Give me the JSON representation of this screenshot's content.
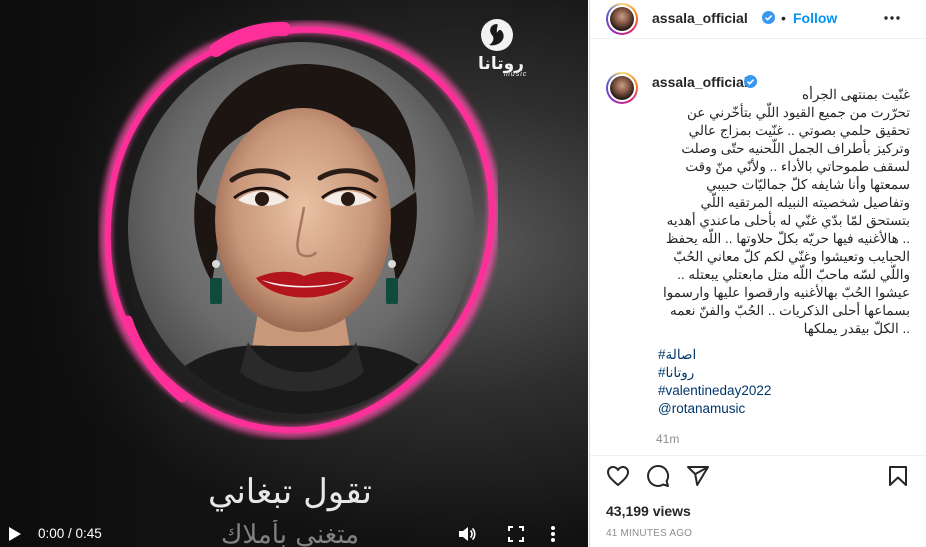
{
  "media": {
    "logo_text": "روتانا",
    "logo_sub": "music",
    "cover_title": "تقول تبغاني",
    "cover_subtitle": "متغنى بأملاك",
    "player": {
      "time": "0:00 / 0:45",
      "ring_color": "#ff2f9a"
    }
  },
  "header": {
    "username": "assala_official",
    "separator": "•",
    "follow_label": "Follow"
  },
  "caption": {
    "username": "assala_official",
    "text": "غنّيت بمنتهى الجرأه\nتحرّرت من جميع القيود اللّي بتأخّرني عن\nتحقيق حلمي بصوتي .. غنّيت بمزاج عالي\nوتركيز بأطراف الجمل اللّحنيه حتّى وصلت\nلسقف طموحاتي بالأداء .. ولأنّي منّ وقت\nسمعتها وأنا شايفه كلّ جماليّات حبيبي\nوتفاصيل شخصيته النبيله المرتقيه اللّي\nبتستحق لمّا بدّي غنّي له بأحلى ماعندي أهديه\n.. هالأغنيه فيها حريّه بكلّ حلاوتها .. اللّه يحفظ\nالحبايب وتعيشوا وغنّي لكم كلّ معاني الحُبّ\nواللّي لسّه ماحبّ اللّه متل مابعتلي يبعتله ..\nعيشوا الحُبّ بهالأغنيه وارقصوا عليها وارسموا\nبسماعها أحلى الذكريات .. الحُبّ والفنّ نعمه\n.. الكلّ بيقدر يملكها",
    "hashtags": [
      "#اصالة",
      "#روتانا",
      "#valentineday2022",
      "@rotanamusic"
    ],
    "time_short": "41m"
  },
  "footer": {
    "views": "43,199 views",
    "time_ago": "41 MINUTES AGO"
  },
  "colors": {
    "accent": "#0095f6",
    "hashtag": "#00376b",
    "verified": "#3897f0",
    "muted": "#8e8e8e"
  }
}
